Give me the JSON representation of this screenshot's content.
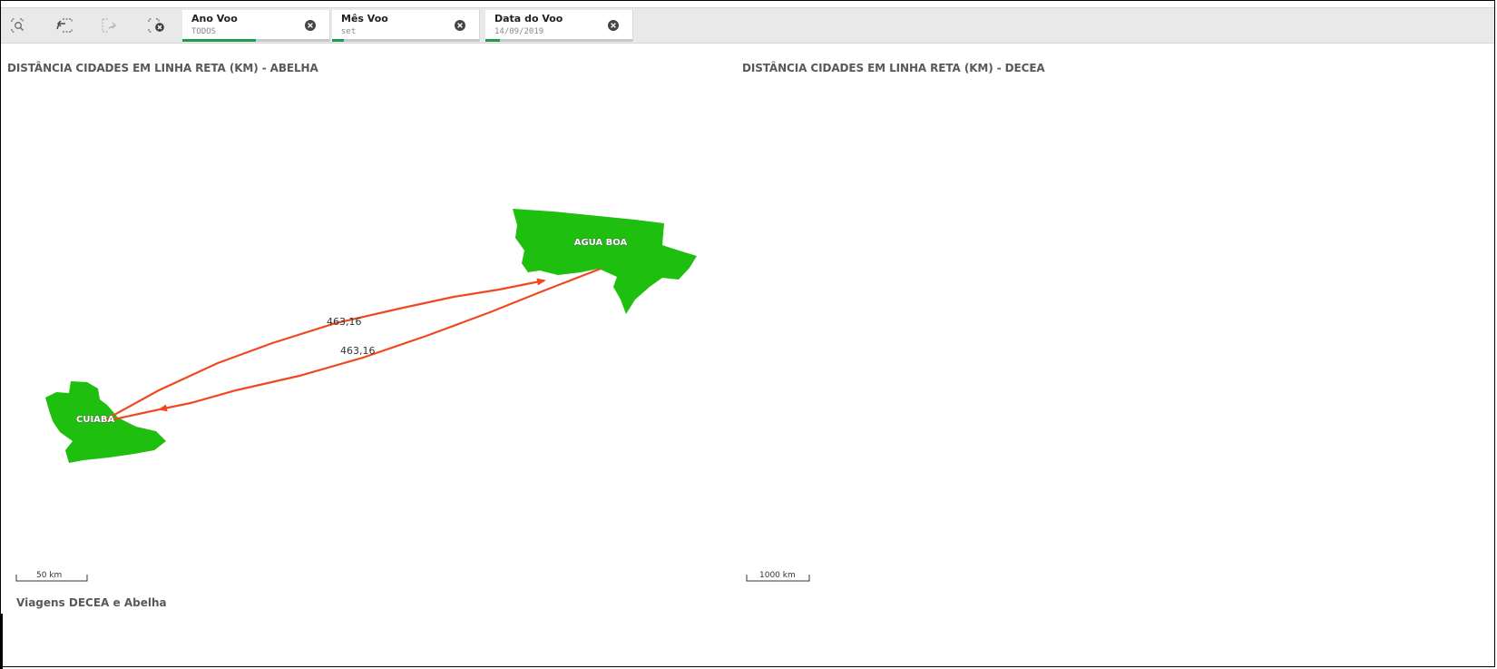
{
  "toolbar": {
    "tools": [
      {
        "name": "smart-search-icon"
      },
      {
        "name": "step-back-icon"
      },
      {
        "name": "step-forward-icon"
      },
      {
        "name": "clear-selections-icon"
      }
    ],
    "filters": [
      {
        "label": "Ano Voo",
        "value": "TODOS",
        "selected_fraction": 0.5
      },
      {
        "label": "Mês Voo",
        "value": "set",
        "selected_fraction": 0.08
      },
      {
        "label": "Data do Voo",
        "value": "14/09/2019",
        "selected_fraction": 0.1
      }
    ]
  },
  "left_chart": {
    "title": "DISTÂNCIA CIDADES EM LINHA RETA (KM) - ABELHA",
    "cities": [
      {
        "label": "AGUA BOA"
      },
      {
        "label": "CUIABA"
      }
    ],
    "routes": [
      {
        "from": "CUIABA",
        "to": "AGUA BOA",
        "distance_label": "463,16"
      },
      {
        "from": "AGUA BOA",
        "to": "CUIABA",
        "distance_label": "463,16"
      }
    ],
    "scale_label": "50 km",
    "colors": {
      "region": "#1fbf0f",
      "route": "#f0491f"
    }
  },
  "right_chart": {
    "title": "DISTÂNCIA CIDADES EM LINHA RETA (KM) - DECEA",
    "scale_label": "1000 km"
  },
  "footer": {
    "title": "Viagens DECEA e Abelha"
  }
}
